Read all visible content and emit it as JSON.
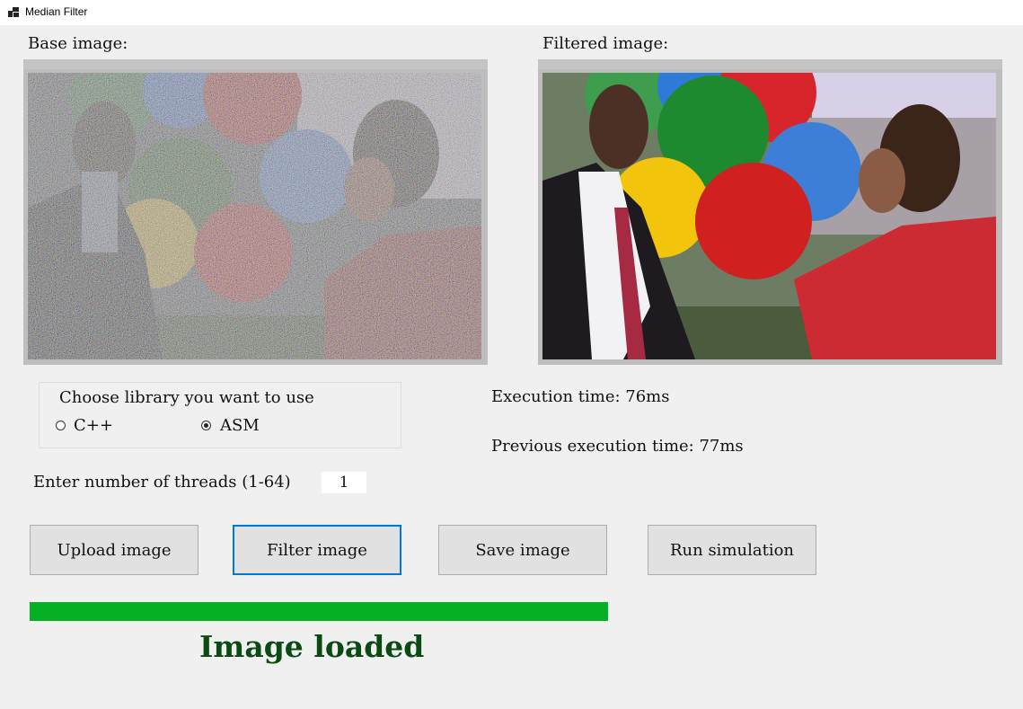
{
  "window": {
    "title": "Median Filter",
    "icon": "app-window-icon"
  },
  "base_image": {
    "label": "Base image:"
  },
  "filtered_image": {
    "label": "Filtered image:"
  },
  "library": {
    "prompt": "Choose library you want to use",
    "options": [
      {
        "label": "C++",
        "checked": false
      },
      {
        "label": "ASM",
        "checked": true
      }
    ]
  },
  "threads": {
    "label": "Enter number of threads (1-64)",
    "value": "1"
  },
  "execution": {
    "current": "Execution time: 76ms",
    "previous": "Previous execution time: 77ms"
  },
  "buttons": {
    "upload": "Upload image",
    "filter": "Filter image",
    "save": "Save image",
    "simulate": "Run simulation"
  },
  "progress": {
    "fraction": 1.0,
    "color": "#06b025"
  },
  "status": {
    "text": "Image loaded",
    "color": "#0b4a12"
  }
}
